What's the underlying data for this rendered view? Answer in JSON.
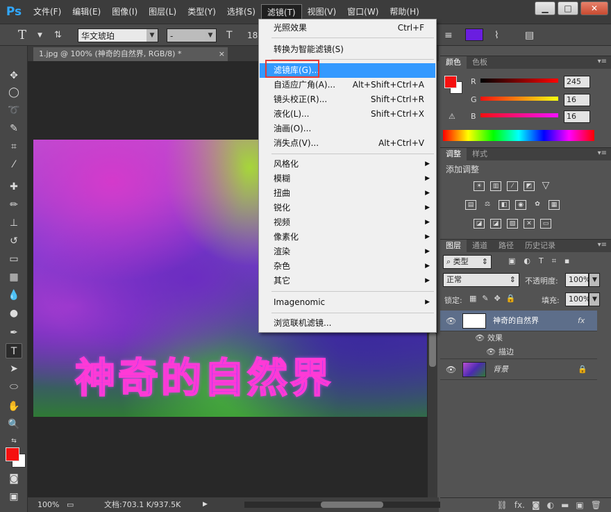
{
  "app": {
    "logo": "Ps"
  },
  "menubar": [
    "文件(F)",
    "编辑(E)",
    "图像(I)",
    "图层(L)",
    "类型(Y)",
    "选择(S)",
    "滤镜(T)",
    "视图(V)",
    "窗口(W)",
    "帮助(H)"
  ],
  "window_controls": [
    "▁",
    "□",
    "✕"
  ],
  "options": {
    "tool_glyph": "T",
    "font": "华文琥珀",
    "style": "-",
    "size_prefix": "18"
  },
  "document": {
    "tab": "1.jpg @ 100% (神奇的自然界, RGB/8) *",
    "close": "×",
    "image_text": "神奇的自然界"
  },
  "status": {
    "zoom": "100%",
    "doc": "文档:703.1 K/937.5K"
  },
  "filter_menu": {
    "items": [
      {
        "label": "光照效果",
        "shortcut": "Ctrl+F"
      },
      {
        "label": "转换为智能滤镜(S)"
      },
      {
        "label": "滤镜库(G)...",
        "highlight": true
      },
      {
        "label": "自适应广角(A)...",
        "shortcut": "Alt+Shift+Ctrl+A"
      },
      {
        "label": "镜头校正(R)...",
        "shortcut": "Shift+Ctrl+R"
      },
      {
        "label": "液化(L)...",
        "shortcut": "Shift+Ctrl+X"
      },
      {
        "label": "油画(O)..."
      },
      {
        "label": "消失点(V)...",
        "shortcut": "Alt+Ctrl+V"
      },
      {
        "label": "风格化",
        "submenu": true
      },
      {
        "label": "模糊",
        "submenu": true
      },
      {
        "label": "扭曲",
        "submenu": true
      },
      {
        "label": "锐化",
        "submenu": true
      },
      {
        "label": "视频",
        "submenu": true
      },
      {
        "label": "像素化",
        "submenu": true
      },
      {
        "label": "渲染",
        "submenu": true
      },
      {
        "label": "杂色",
        "submenu": true
      },
      {
        "label": "其它",
        "submenu": true
      },
      {
        "label": "Imagenomic",
        "submenu": true
      },
      {
        "label": "浏览联机滤镜..."
      }
    ]
  },
  "color_panel": {
    "tabs": [
      "颜色",
      "色板"
    ],
    "r_label": "R",
    "g_label": "G",
    "b_label": "B",
    "r": "245",
    "g": "16",
    "b": "16",
    "fg_color": "#f5100f"
  },
  "adjust_panel": {
    "tabs": [
      "调整",
      "样式"
    ],
    "title": "添加调整"
  },
  "layers_panel": {
    "tabs": [
      "图层",
      "通道",
      "路径",
      "历史记录"
    ],
    "filter_type": "类型",
    "blend_mode": "正常",
    "opacity_label": "不透明度:",
    "opacity": "100%",
    "lock_label": "锁定:",
    "fill_label": "填充:",
    "fill": "100%",
    "layers": [
      {
        "name": "神奇的自然界",
        "fx": "fx",
        "selected": true
      },
      {
        "name": "效果",
        "sub": true
      },
      {
        "name": "描边",
        "sub": true
      },
      {
        "name": "背景",
        "italic": true
      }
    ]
  },
  "colors": {
    "accent": "#3399ff",
    "callout": "#e53935"
  }
}
